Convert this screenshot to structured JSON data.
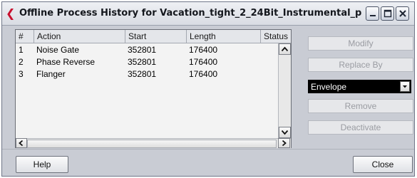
{
  "window": {
    "title": "Offline Process History for Vacation_tight_2_24Bit_Instrumental_p..."
  },
  "list": {
    "columns": [
      "#",
      "Action",
      "Start",
      "Length",
      "Status"
    ],
    "rows": [
      {
        "index": "1",
        "action": "Noise Gate",
        "start": "352801",
        "length": "176400",
        "status": ""
      },
      {
        "index": "2",
        "action": "Phase Reverse",
        "start": "352801",
        "length": "176400",
        "status": ""
      },
      {
        "index": "3",
        "action": "Flanger",
        "start": "352801",
        "length": "176400",
        "status": ""
      }
    ]
  },
  "side_buttons": {
    "modify": "Modify",
    "replace_by": "Replace By",
    "remove": "Remove",
    "deactivate": "Deactivate"
  },
  "replace_select": {
    "selected": "Envelope"
  },
  "footer": {
    "help": "Help",
    "close": "Close"
  },
  "colors": {
    "window_bg": "#c9ccd4",
    "disabled_text": "#9a9ca2",
    "title_icon": "#c8102e"
  },
  "icons": {
    "title": "cubase-logo-icon",
    "minimize": "minimize-icon",
    "maximize": "maximize-icon",
    "close": "close-icon",
    "scroll_up": "scroll-up-arrow-icon",
    "scroll_down": "scroll-down-arrow-icon",
    "scroll_left": "scroll-left-arrow-icon",
    "scroll_right": "scroll-right-arrow-icon",
    "dropdown": "dropdown-arrow-icon"
  }
}
